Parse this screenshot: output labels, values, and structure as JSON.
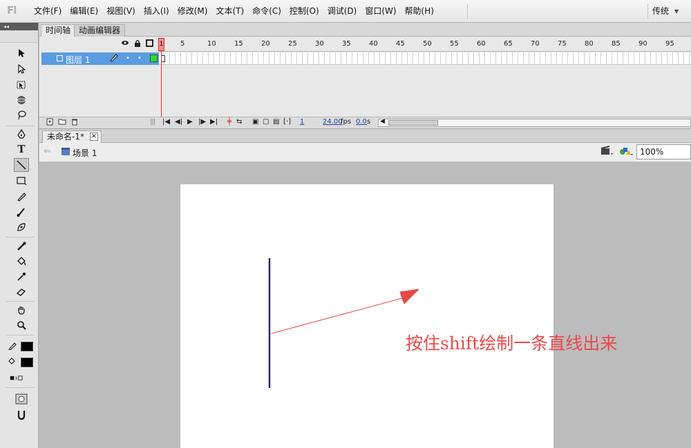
{
  "app": {
    "logo": "Fl"
  },
  "menu": [
    "文件(F)",
    "编辑(E)",
    "视图(V)",
    "插入(I)",
    "修改(M)",
    "文本(T)",
    "命令(C)",
    "控制(O)",
    "调试(D)",
    "窗口(W)",
    "帮助(H)"
  ],
  "workspace": {
    "label": "传统"
  },
  "toolbar": {
    "collapse_glyph": "◂◂"
  },
  "timeline": {
    "tabs": [
      "时间轴",
      "动画编辑器"
    ],
    "ruler": [
      "1",
      "5",
      "10",
      "15",
      "20",
      "25",
      "30",
      "35",
      "40",
      "45",
      "50",
      "55",
      "60",
      "65",
      "70",
      "75",
      "80",
      "85",
      "90",
      "95"
    ],
    "layer": {
      "name": "图层 1"
    },
    "current_frame": "1",
    "frame_number": "1",
    "fps": "24.00",
    "fps_unit": "fps",
    "elapsed": "0.0",
    "elapsed_unit": "s"
  },
  "document": {
    "tab_title": "未命名-1*",
    "close_glyph": "✕"
  },
  "editbar": {
    "scene": "场景 1",
    "zoom": "100%"
  },
  "stage": {
    "line_color": "#2a2766",
    "arrow_color": "#e84a4a"
  },
  "annotation": {
    "text": "按住shift绘制一条直线出来"
  }
}
